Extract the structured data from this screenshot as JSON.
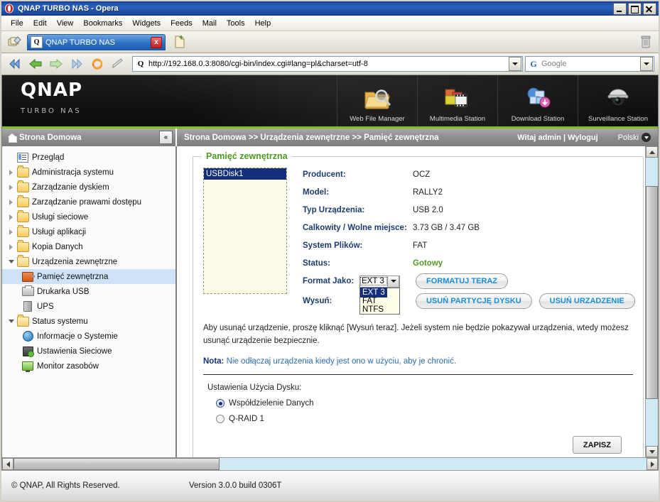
{
  "window": {
    "title": "QNAP TURBO NAS - Opera",
    "icon": "opera-icon",
    "controls": {
      "minimize": "Minimize",
      "maximize": "Maximize",
      "close": "Close"
    }
  },
  "menubar": {
    "items": [
      "File",
      "Edit",
      "View",
      "Bookmarks",
      "Widgets",
      "Feeds",
      "Mail",
      "Tools",
      "Help"
    ]
  },
  "tabbar": {
    "panel_toggle": "panels-icon",
    "tabs": [
      {
        "title": "QNAP TURBO NAS",
        "favicon": "Q",
        "close": "x"
      }
    ],
    "new_tab": "new-tab-icon",
    "trash": "trash-icon"
  },
  "addressbar": {
    "buttons": [
      "rewind-icon",
      "back-icon",
      "forward-icon",
      "fast-forward-icon",
      "reload-icon",
      "edit-icon"
    ],
    "url": "http://192.168.0.3:8080/cgi-bin/index.cgi#lang=pl&charset=utf-8",
    "url_icon": "Q",
    "search_placeholder": "Google",
    "search_icon": "G"
  },
  "banner": {
    "brand": "QNAP",
    "tagline": "TURBO NAS",
    "stations": [
      {
        "label": "Web File Manager",
        "icon": "folder-search-icon"
      },
      {
        "label": "Multimedia Station",
        "icon": "photos-film-icon"
      },
      {
        "label": "Download Station",
        "icon": "download-cloud-icon"
      },
      {
        "label": "Surveillance Station",
        "icon": "dome-camera-icon"
      }
    ]
  },
  "navstrip": {
    "home_label": "Strona Domowa",
    "home_icon": "home-icon",
    "collapse_icon": "«",
    "breadcrumb": "Strona Domowa >> Urządzenia zewnętrzne >> Pamięć zewnętrzna",
    "welcome": "Witaj admin | Wyloguj",
    "language": "Polski"
  },
  "sidebar": {
    "items": [
      {
        "label": "Przegląd",
        "icon": "overview-icon",
        "level": 1,
        "expander": "none",
        "selected": false
      },
      {
        "label": "Administracja systemu",
        "icon": "folder-icon",
        "level": 1,
        "expander": "closed",
        "selected": false
      },
      {
        "label": "Zarządzanie dyskiem",
        "icon": "folder-icon",
        "level": 1,
        "expander": "closed",
        "selected": false
      },
      {
        "label": "Zarządzanie prawami dostępu",
        "icon": "folder-icon",
        "level": 1,
        "expander": "closed",
        "selected": false
      },
      {
        "label": "Usługi sieciowe",
        "icon": "folder-icon",
        "level": 1,
        "expander": "closed",
        "selected": false
      },
      {
        "label": "Usługi aplikacji",
        "icon": "folder-icon",
        "level": 1,
        "expander": "closed",
        "selected": false
      },
      {
        "label": "Kopia Danych",
        "icon": "folder-icon",
        "level": 1,
        "expander": "closed",
        "selected": false
      },
      {
        "label": "Urządzenia zewnętrzne",
        "icon": "folder-open-icon",
        "level": 1,
        "expander": "open",
        "selected": false
      },
      {
        "label": "Pamięć zewnętrzna",
        "icon": "usb-storage-icon",
        "level": 2,
        "expander": "none",
        "selected": true
      },
      {
        "label": "Drukarka USB",
        "icon": "printer-icon",
        "level": 2,
        "expander": "none",
        "selected": false
      },
      {
        "label": "UPS",
        "icon": "ups-icon",
        "level": 2,
        "expander": "none",
        "selected": false
      },
      {
        "label": "Status systemu",
        "icon": "folder-open-icon",
        "level": 1,
        "expander": "open",
        "selected": false
      },
      {
        "label": "Informacje o Systemie",
        "icon": "system-info-icon",
        "level": 2,
        "expander": "none",
        "selected": false
      },
      {
        "label": "Ustawienia Sieciowe",
        "icon": "network-settings-icon",
        "level": 2,
        "expander": "none",
        "selected": false
      },
      {
        "label": "Monitor zasobów",
        "icon": "resource-monitor-icon",
        "level": 2,
        "expander": "none",
        "selected": false
      }
    ]
  },
  "main": {
    "panel_title": "Pamięć zewnętrzna",
    "device_list": [
      {
        "name": "USBDisk1",
        "selected": true
      }
    ],
    "fields": [
      {
        "label": "Producent:",
        "value": "OCZ",
        "status": false
      },
      {
        "label": "Model:",
        "value": "RALLY2",
        "status": false
      },
      {
        "label": "Typ Urządzenia:",
        "value": "USB 2.0",
        "status": false
      },
      {
        "label": "Calkowity / Wolne miejsce:",
        "value": "3.73 GB / 3.47 GB",
        "status": false
      },
      {
        "label": "System Plików:",
        "value": "FAT",
        "status": false
      },
      {
        "label": "Status:",
        "value": "Gotowy",
        "status": true
      }
    ],
    "format": {
      "label": "Format Jako:",
      "selected": "EXT 3",
      "options": [
        "EXT 3",
        "FAT",
        "NTFS"
      ],
      "open": true,
      "button": "FORMATUJ TERAZ"
    },
    "eject": {
      "label": "Wysuń:",
      "buttons": [
        "USUŃ PARTYCJĘ DYSKU",
        "USUŃ URZADZENIE"
      ]
    },
    "description": "Aby usunąć urządzenie, proszę kliknąć [Wysuń teraz]. Jeżeli system nie będzie pokazywał urządzenia, wtedy możesz usunąć urządzenie bezpiecznie.",
    "note_label": "Nota:",
    "note_text": "Nie odłączaj urządzenia kiedy jest ono w użyciu, aby je chronić.",
    "usage": {
      "title": "Ustawienia Użycia Dysku:",
      "options": [
        {
          "label": "Współdzielenie Danych",
          "selected": true
        },
        {
          "label": "Q-RAID 1",
          "selected": false
        }
      ]
    },
    "save_button": "ZAPISZ"
  },
  "footer": {
    "copyright": "© QNAP, All Rights Reserved.",
    "version": "Version 3.0.0 build 0306T"
  },
  "colors": {
    "accent_green": "#7fbd2b",
    "link_blue": "#1a8fd8",
    "status_ok": "#4f9b22",
    "select_navy": "#15307b",
    "title_blue": "#2a63c0"
  }
}
